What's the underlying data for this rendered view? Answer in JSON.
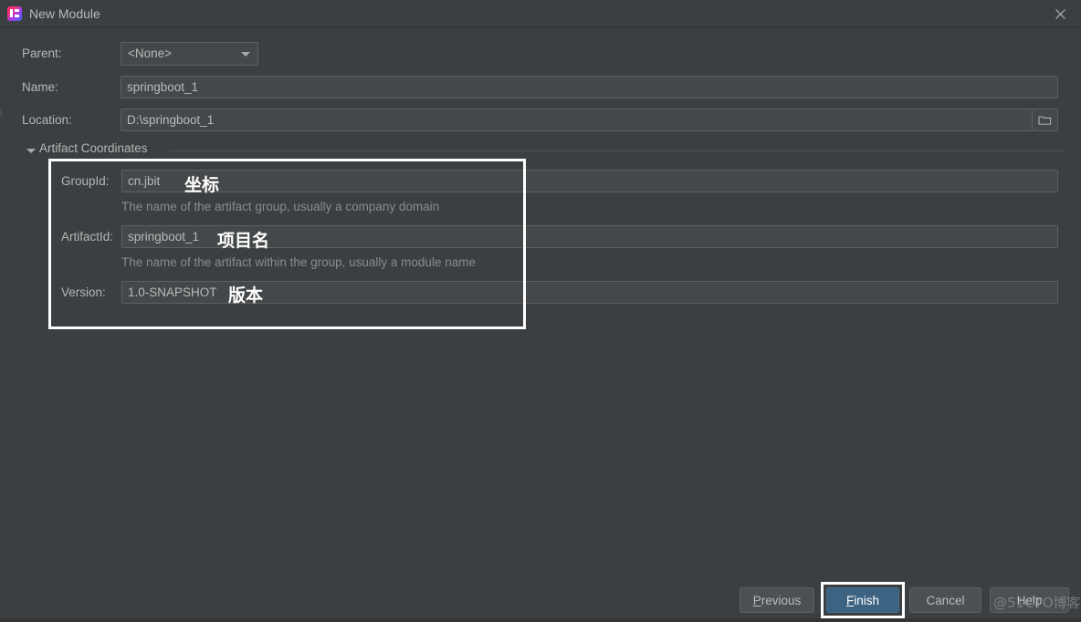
{
  "window": {
    "title": "New Module",
    "app_icon": "intellij-idea-icon",
    "close_icon": "close-icon"
  },
  "form": {
    "parent": {
      "label": "Parent:",
      "value": "<None>",
      "chevron_icon": "chevron-down-icon"
    },
    "name": {
      "label": "Name:",
      "value": "springboot_1"
    },
    "location": {
      "label": "Location:",
      "value": "D:\\springboot_1",
      "browse_icon": "folder-icon"
    }
  },
  "artifact_coordinates": {
    "section_title": "Artifact Coordinates",
    "expanded": true,
    "collapse_icon": "triangle-down-icon",
    "fields": [
      {
        "label": "GroupId:",
        "value": "cn.jbit",
        "hint": "The name of the artifact group, usually a company domain",
        "annotation": "坐标"
      },
      {
        "label": "ArtifactId:",
        "value": "springboot_1",
        "hint": "The name of the artifact within the group, usually a module name",
        "annotation": "项目名"
      },
      {
        "label": "Version:",
        "value": "1.0-SNAPSHOT",
        "hint": "",
        "annotation": "版本"
      }
    ]
  },
  "buttons": {
    "previous": {
      "label": "Previous",
      "mnemonic": "P",
      "rest": "revious"
    },
    "finish": {
      "label": "Finish",
      "mnemonic": "F",
      "rest": "inish"
    },
    "cancel": {
      "label": "Cancel"
    },
    "help": {
      "label": "Help"
    }
  },
  "watermark": {
    "text": "@51CTO博客"
  },
  "colors": {
    "dialog_background": "#3c3f41",
    "field_background": "#45484a",
    "field_border": "#5e6060",
    "text": "#b9b9b9",
    "hint_text": "#888c8e",
    "primary_button": "#3c6382",
    "annotation": "#ffffff"
  }
}
